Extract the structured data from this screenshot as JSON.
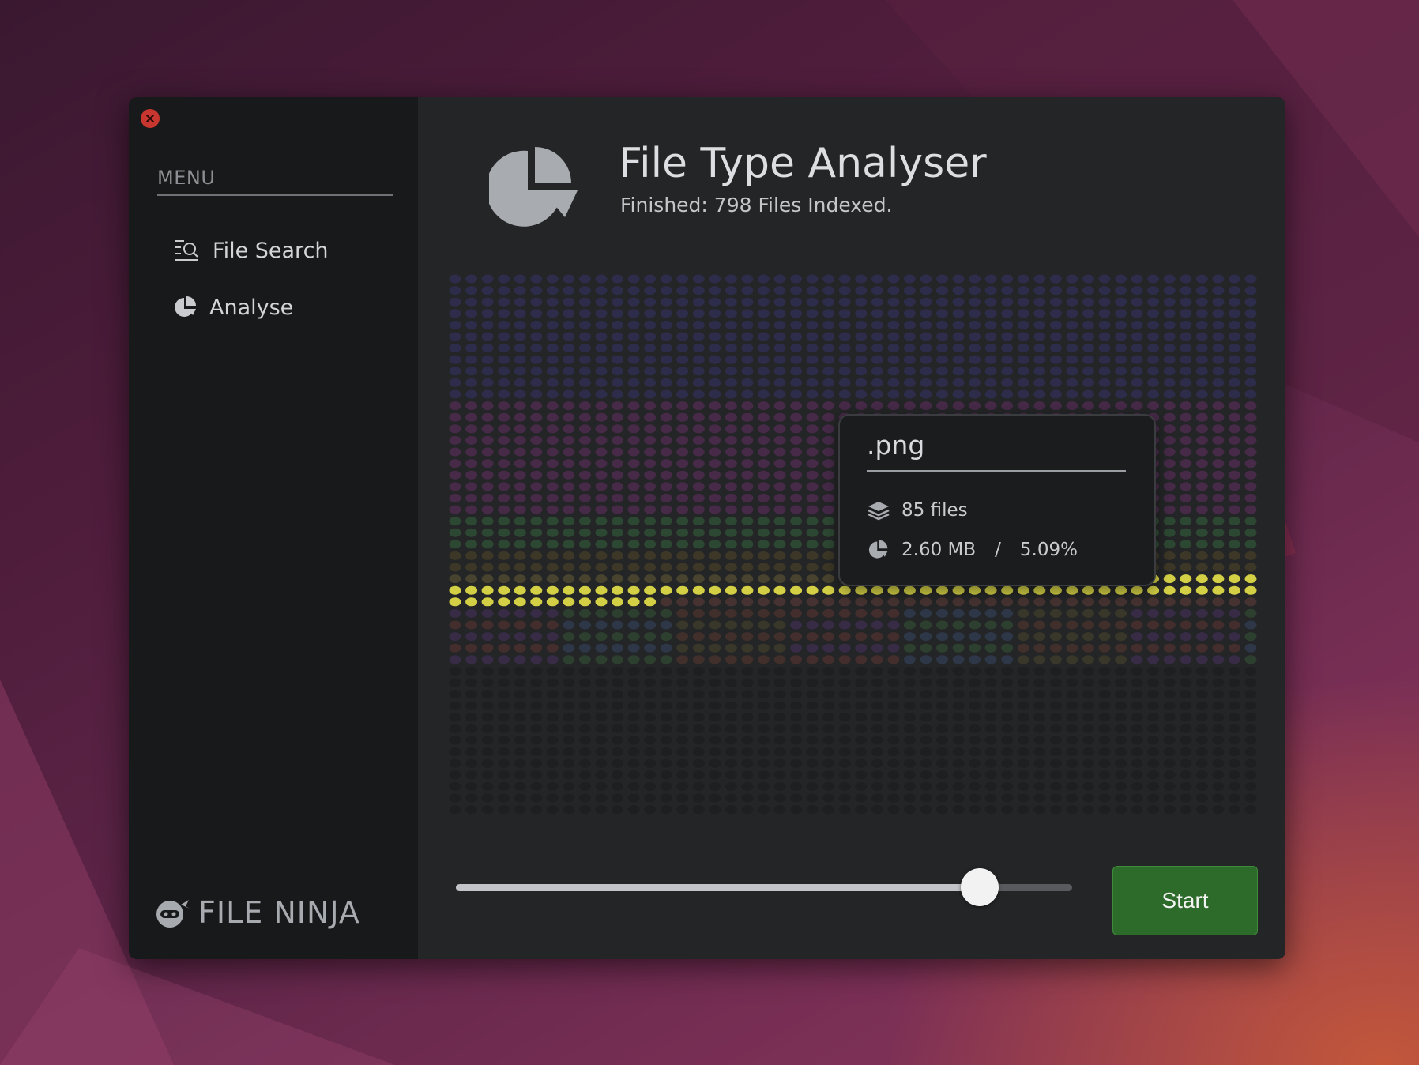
{
  "colors": {
    "accent_green": "#2d6b2a",
    "close_red": "#c7372f",
    "png_highlight": "#d4d046"
  },
  "sidebar": {
    "menu_label": "MENU",
    "items": [
      {
        "label": "File Search",
        "icon": "file-search-icon"
      },
      {
        "label": "Analyse",
        "icon": "pie-chart-icon"
      }
    ],
    "brand": "FILE NINJA",
    "brand_icon": "ninja-icon"
  },
  "header": {
    "title": "File Type Analyser",
    "status": "Finished: 798 Files Indexed.",
    "icon": "pie-chart-icon"
  },
  "tooltip": {
    "extension": ".png",
    "files": "85 files",
    "size": "2.60 MB",
    "percent": "5.09%",
    "files_icon": "layers-icon",
    "size_icon": "pie-chart-icon"
  },
  "slider": {
    "value_fraction": 0.85
  },
  "actions": {
    "start_label": "Start"
  }
}
